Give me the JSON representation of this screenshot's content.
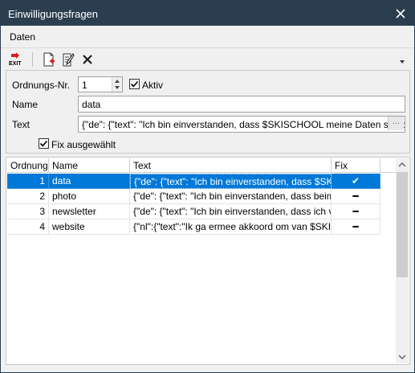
{
  "window": {
    "title": "Einwilligungsfragen"
  },
  "menu": {
    "items": [
      "Daten"
    ]
  },
  "toolbar": {
    "exit_label": "EXIT",
    "buttons": [
      "exit-icon",
      "new-document-icon",
      "edit-icon",
      "delete-icon"
    ]
  },
  "form": {
    "order_label": "Ordnungs-Nr.",
    "order_value": "1",
    "active_label": "Aktiv",
    "active_checked": true,
    "name_label": "Name",
    "name_value": "data",
    "text_label": "Text",
    "text_value": "{\"de\": {\"text\": \"Ich bin einverstanden, dass $SKISCHOOL meine Daten speicher",
    "ellipsis_label": "...",
    "fix_label": "Fix ausgewählt",
    "fix_checked": true
  },
  "grid": {
    "columns": [
      "Ordnung",
      "Name",
      "Text",
      "Fix"
    ],
    "rows": [
      {
        "ordnung": "1",
        "name": "data",
        "text": "{\"de\": {\"text\": \"Ich bin einverstanden, dass $SKISCHOOL",
        "fix": "✔",
        "selected": true
      },
      {
        "ordnung": "2",
        "name": "photo",
        "text": "{\"de\": {\"text\": \"Ich bin einverstanden, dass beim Ski",
        "fix": "━",
        "selected": false
      },
      {
        "ordnung": "3",
        "name": "newsletter",
        "text": "{\"de\": {\"text\": \"Ich bin einverstanden, dass ich von",
        "fix": "━",
        "selected": false
      },
      {
        "ordnung": "4",
        "name": "website",
        "text": "{\"nl\":{\"text\":\"Ik ga ermee akkoord om van $SKISCHOOL",
        "fix": "━",
        "selected": false
      }
    ]
  },
  "colors": {
    "titlebar": "#2b3e50",
    "selection": "#0078d7",
    "exit_red": "#d42020"
  }
}
